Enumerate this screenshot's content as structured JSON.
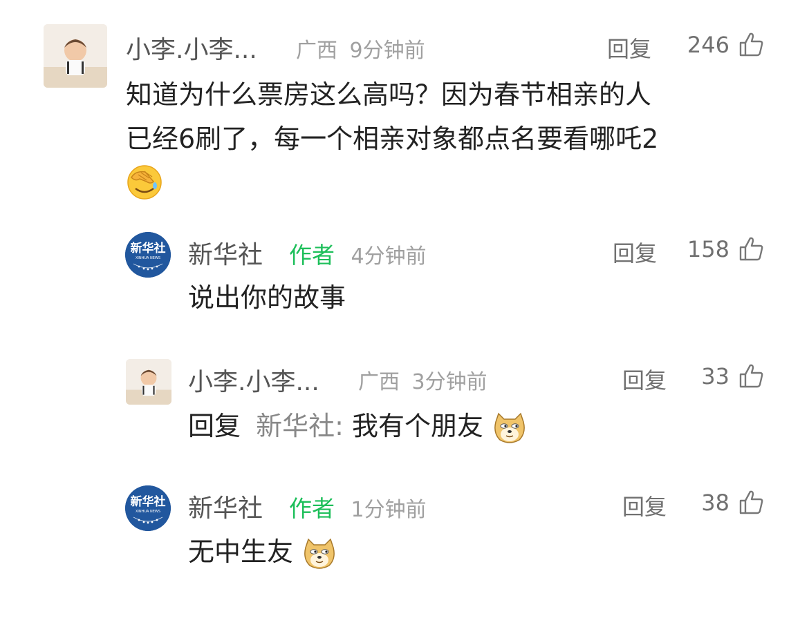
{
  "comments": [
    {
      "name": "小李.小李...",
      "location": "广西",
      "time": "9分钟前",
      "reply": "回复",
      "likes": "246",
      "line1": "知道为什么票房这么高吗？因为春节相亲的人",
      "line2": "已经6刷了，每一个相亲对象都点名要看哪吒2",
      "emoji": "facepalm-emoji"
    },
    {
      "name": "新华社",
      "author_tag": "作者",
      "time": "4分钟前",
      "reply": "回复",
      "likes": "158",
      "text": "说出你的故事",
      "avatar_text": "新华社",
      "avatar_sub": "XINHUA NEWS"
    },
    {
      "name": "小李.小李...",
      "location": "广西",
      "time": "3分钟前",
      "reply": "回复",
      "likes": "33",
      "text_prefix": "回复",
      "text_ref": "新华社:",
      "text": "我有个朋友",
      "emoji": "doge-emoji"
    },
    {
      "name": "新华社",
      "author_tag": "作者",
      "time": "1分钟前",
      "reply": "回复",
      "likes": "38",
      "text": "无中生友",
      "emoji": "doge-emoji",
      "avatar_text": "新华社",
      "avatar_sub": "XINHUA NEWS"
    }
  ]
}
